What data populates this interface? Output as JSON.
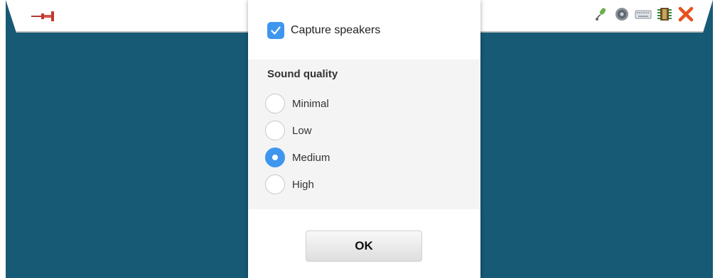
{
  "toolbar": {
    "icons": [
      "pushpin-icon",
      "microphone-icon",
      "speaker-icon",
      "keyboard-icon",
      "chip-icon",
      "close-icon"
    ]
  },
  "dialog": {
    "capture_speakers": {
      "label": "Capture speakers",
      "checked": true
    },
    "sound_quality": {
      "title": "Sound quality",
      "options": [
        "Minimal",
        "Low",
        "Medium",
        "High"
      ],
      "selected": "Medium"
    },
    "ok_label": "OK"
  },
  "colors": {
    "background": "#175a75",
    "accent": "#3f96ee",
    "close": "#e8501e"
  }
}
